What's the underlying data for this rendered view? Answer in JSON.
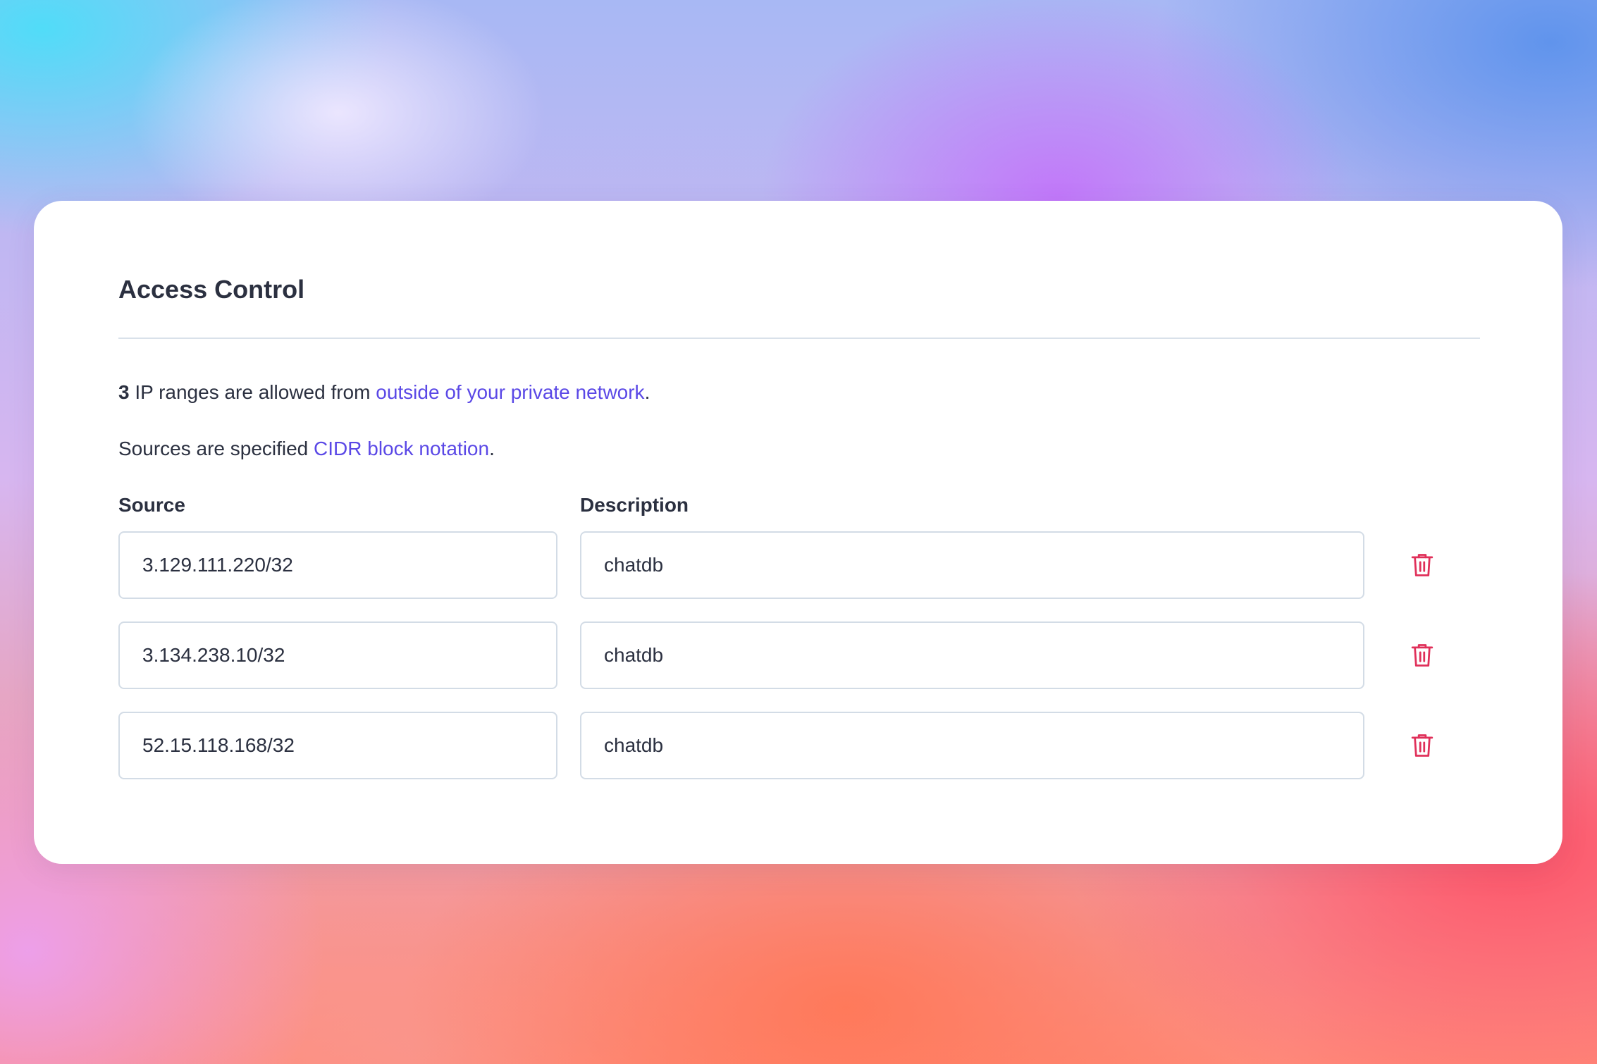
{
  "card": {
    "title": "Access Control",
    "summary": {
      "count": "3",
      "text": " IP ranges are allowed from ",
      "link": "outside of your private network",
      "end": "."
    },
    "notation": {
      "text": "Sources are specified ",
      "link": "CIDR block notation",
      "end": "."
    },
    "columns": {
      "source": "Source",
      "description": "Description"
    },
    "rows": [
      {
        "source": "3.129.111.220/32",
        "description": "chatdb"
      },
      {
        "source": "3.134.238.10/32",
        "description": "chatdb"
      },
      {
        "source": "52.15.118.168/32",
        "description": "chatdb"
      }
    ]
  },
  "icons": {
    "delete": "trash-icon"
  },
  "colors": {
    "link": "#5a48e6",
    "delete": "#e0305a",
    "text": "#2b3040"
  }
}
